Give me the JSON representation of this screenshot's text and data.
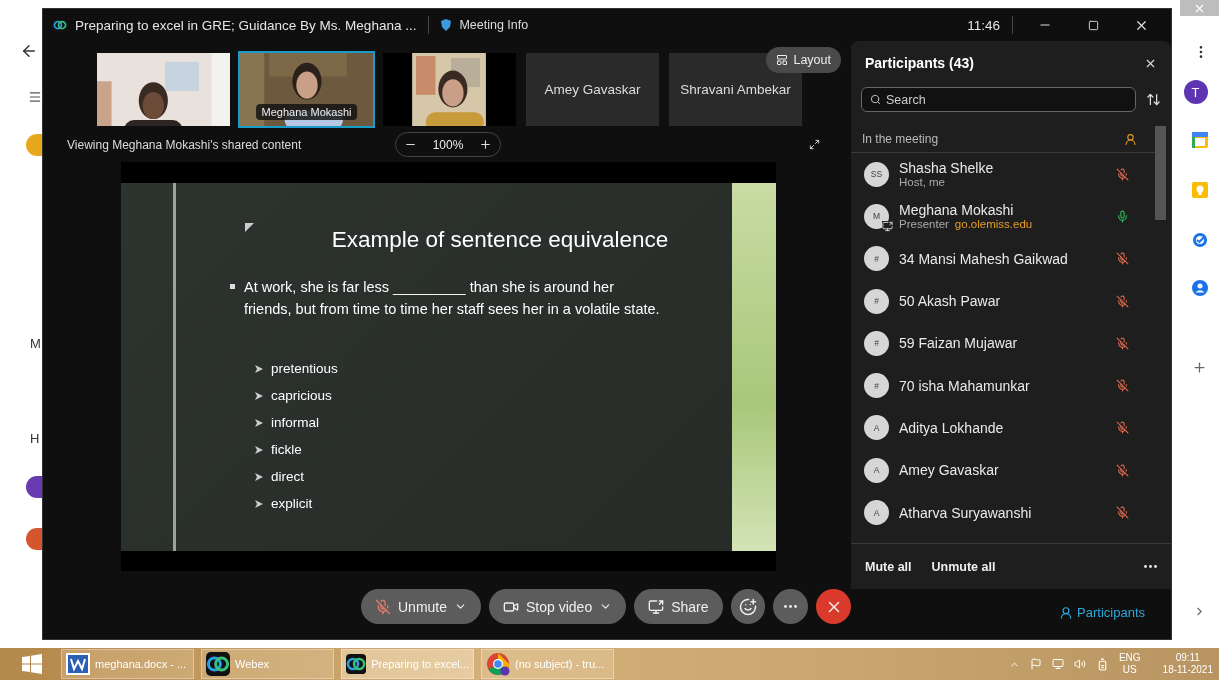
{
  "browser_behind": {
    "side_letters": [
      "M",
      "H"
    ],
    "avatar": "T"
  },
  "window": {
    "title": "Preparing to excel in GRE; Guidance By Ms. Meghana ...",
    "meeting_info": "Meeting Info",
    "time": "11:46"
  },
  "videos": [
    {
      "kind": "video",
      "selected": false
    },
    {
      "kind": "video",
      "selected": true,
      "label": "Meghana Mokashi"
    },
    {
      "kind": "video",
      "selected": false
    },
    {
      "kind": "name",
      "name": "Amey Gavaskar",
      "selected": false
    },
    {
      "kind": "name",
      "name": "Shravani Ambekar",
      "selected": false
    }
  ],
  "layout_button": "Layout",
  "share": {
    "viewing": "Viewing Meghana Mokashi's shared content",
    "zoom": "100%"
  },
  "slide": {
    "title": "Example of sentence equivalence",
    "question_lines": [
      "At work, she is far less _________ than she is around her",
      "friends, but from time to time her staff sees her in a volatile state."
    ],
    "options": [
      "pretentious",
      "capricious",
      "informal",
      "fickle",
      "direct",
      "explicit"
    ]
  },
  "controls": {
    "unmute": "Unmute",
    "stop_video": "Stop video",
    "share": "Share"
  },
  "participants": {
    "title": "Participants (43)",
    "search": {
      "placeholder": "Search"
    },
    "section": "In the meeting",
    "people": [
      {
        "initials": "SS",
        "name": "Shasha Shelke",
        "role": "Host, me",
        "sharing": false,
        "muted": true
      },
      {
        "initials": "M",
        "name": "Meghana Mokashi",
        "role": "Presenter",
        "link": "go.olemiss.edu",
        "sharing": true,
        "muted": false
      },
      {
        "initials": "#",
        "name": "34 Mansi Mahesh Gaikwad",
        "sharing": false,
        "muted": true
      },
      {
        "initials": "#",
        "name": "50 Akash Pawar",
        "sharing": false,
        "muted": true
      },
      {
        "initials": "#",
        "name": "59 Faizan Mujawar",
        "sharing": false,
        "muted": true
      },
      {
        "initials": "#",
        "name": "70 isha Mahamunkar",
        "sharing": false,
        "muted": true
      },
      {
        "initials": "A",
        "name": "Aditya Lokhande",
        "sharing": false,
        "muted": true
      },
      {
        "initials": "A",
        "name": "Amey Gavaskar",
        "sharing": false,
        "muted": true
      },
      {
        "initials": "A",
        "name": "Atharva Suryawanshi",
        "sharing": false,
        "muted": true
      }
    ],
    "footer": [
      "Mute all",
      "Unmute all"
    ],
    "panel_button": "Participants"
  },
  "taskbar": {
    "items": [
      {
        "kind": "word",
        "label": "meghana.docx - ...",
        "selected": false
      },
      {
        "kind": "webex",
        "label": "Webex",
        "selected": false
      },
      {
        "kind": "webex",
        "label": "Preparing to excel...",
        "selected": true
      },
      {
        "kind": "chrome",
        "label": "(no subject) - tru...",
        "selected": false
      }
    ],
    "language": [
      "ENG",
      "US"
    ],
    "time": "09:11",
    "date": "18-11-2021"
  }
}
